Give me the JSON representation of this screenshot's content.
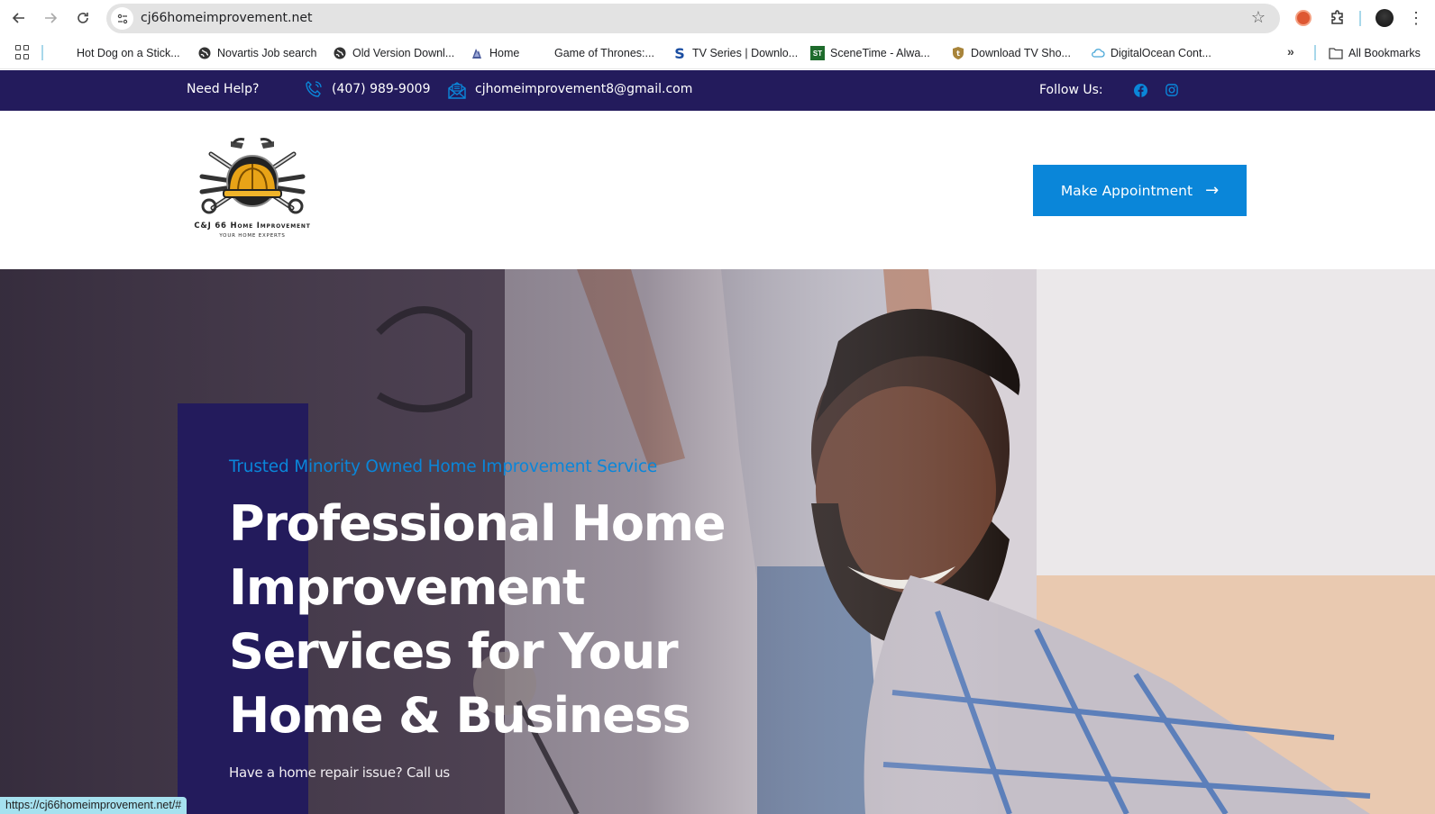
{
  "browser": {
    "url": "cj66homeimprovement.net",
    "status_url": "https://cj66homeimprovement.net/#",
    "bookmarks": [
      {
        "label": "Hot Dog on a Stick...",
        "icon": "none"
      },
      {
        "label": "Novartis Job search",
        "icon": "globe-icon"
      },
      {
        "label": "Old Version Downl...",
        "icon": "globe-icon"
      },
      {
        "label": "Home",
        "icon": "site-logo-icon"
      },
      {
        "label": "Game of Thrones:...",
        "icon": "none"
      },
      {
        "label": "TV Series | Downlo...",
        "icon": "s-logo-icon"
      },
      {
        "label": "SceneTime - Alwa...",
        "icon": "st-logo-icon"
      },
      {
        "label": "Download TV Sho...",
        "icon": "shield-t-icon"
      },
      {
        "label": "DigitalOcean Cont...",
        "icon": "cloud-icon"
      }
    ],
    "all_bookmarks_label": "All Bookmarks",
    "more_label": "»"
  },
  "topbar": {
    "help_label": "Need Help?",
    "phone": "(407) 989-9009",
    "email": "cjhomeimprovement8@gmail.com",
    "follow_label": "Follow Us:",
    "socials": [
      "facebook-icon",
      "instagram-icon"
    ]
  },
  "header": {
    "logo_title": "C&J 66 Home Improvement",
    "logo_subtitle": "Your Home Experts",
    "cta_label": "Make Appointment",
    "cta_arrow": "→"
  },
  "hero": {
    "tagline": "Trusted Minority Owned Home Improvement Service",
    "headline_lines": [
      "Professional Home",
      "Improvement",
      "Services for Your",
      "Home & Business"
    ],
    "subline": "Have a home repair issue? Call us"
  },
  "colors": {
    "navy": "#231b5c",
    "accent_blue": "#0a86d9",
    "white": "#ffffff"
  }
}
